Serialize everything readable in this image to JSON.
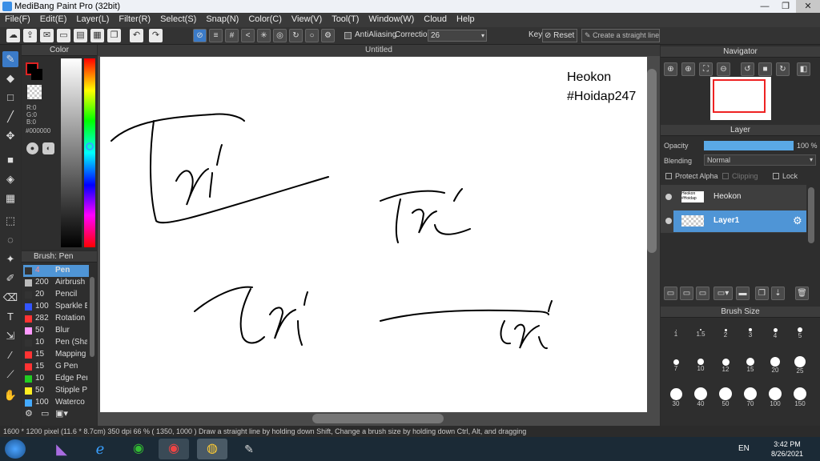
{
  "window": {
    "title": "MediBang Paint Pro (32bit)",
    "controls": [
      "—",
      "❐",
      "✕"
    ]
  },
  "menu": [
    "File(F)",
    "Edit(E)",
    "Layer(L)",
    "Filter(R)",
    "Select(S)",
    "Snap(N)",
    "Color(C)",
    "View(V)",
    "Tool(T)",
    "Window(W)",
    "Cloud",
    "Help"
  ],
  "toolbar": {
    "antialiasing": "AntiAliasing",
    "correction_label": "Correction",
    "correction_value": "26",
    "key_label": "Key",
    "reset": "Reset",
    "straight_line": "Create a straight line"
  },
  "color_panel": {
    "title": "Color",
    "r": "R:0",
    "g": "G:0",
    "b": "B:0",
    "hex": "#000000"
  },
  "brush_panel": {
    "title": "Brush: Pen",
    "items": [
      {
        "size": "4",
        "name": "Pen",
        "color": "#333333",
        "selected": true
      },
      {
        "size": "200",
        "name": "Airbrush",
        "color": "#bbbbbb",
        "selected": false
      },
      {
        "size": "20",
        "name": "Pencil",
        "color": "#333333",
        "selected": false
      },
      {
        "size": "100",
        "name": "Sparkle B",
        "color": "#3355ff",
        "selected": false
      },
      {
        "size": "282",
        "name": "Rotation",
        "color": "#ff3333",
        "selected": false
      },
      {
        "size": "50",
        "name": "Blur",
        "color": "#ff99ff",
        "selected": false
      },
      {
        "size": "10",
        "name": "Pen (Sha",
        "color": "#333333",
        "selected": false
      },
      {
        "size": "15",
        "name": "Mapping",
        "color": "#ff3333",
        "selected": false
      },
      {
        "size": "15",
        "name": "G Pen",
        "color": "#ff3333",
        "selected": false
      },
      {
        "size": "10",
        "name": "Edge Pen",
        "color": "#22cc22",
        "selected": false
      },
      {
        "size": "50",
        "name": "Stipple P",
        "color": "#ffee22",
        "selected": false
      },
      {
        "size": "100",
        "name": "Waterco",
        "color": "#44aaff",
        "selected": false
      }
    ]
  },
  "canvas": {
    "tab": "Untitled",
    "text_line1": "Heokon",
    "text_line2": "#Hoidap247"
  },
  "navigator": {
    "title": "Navigator"
  },
  "layer_panel": {
    "title": "Layer",
    "opacity_label": "Opacity",
    "opacity_value": "100 %",
    "opacity_level": 1.0,
    "blending_label": "Blending",
    "blending_value": "Normal",
    "protect_alpha": "Protect Alpha",
    "clipping": "Clipping",
    "lock": "Lock",
    "layers": [
      {
        "name": "Heokon",
        "selected": false
      },
      {
        "name": "Layer1",
        "selected": true
      }
    ]
  },
  "brush_size": {
    "title": "Brush Size",
    "sizes": [
      "1",
      "1.5",
      "2",
      "3",
      "4",
      "5",
      "7",
      "10",
      "12",
      "15",
      "20",
      "25",
      "30",
      "40",
      "50",
      "70",
      "100",
      "150"
    ]
  },
  "status": "1600 * 1200 pixel   (11.6 * 8.7cm)   350 dpi   66 %   ( 1350, 1000 )   Draw a straight line by holding down Shift, Change a brush size by holding down Ctrl, Alt, and dragging",
  "taskbar": {
    "lang": "EN",
    "time": "3:42 PM",
    "date": "8/26/2021"
  }
}
